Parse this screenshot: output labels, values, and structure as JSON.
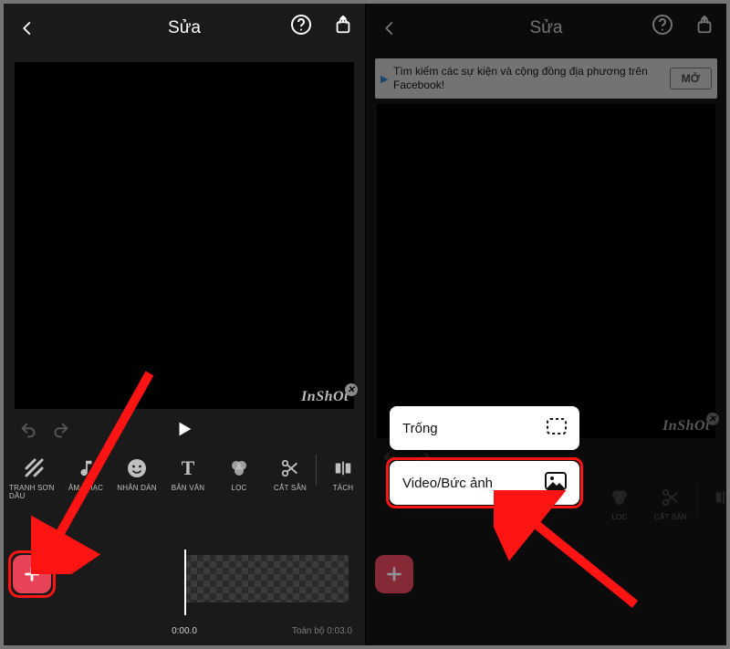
{
  "header": {
    "title": "Sửa"
  },
  "ad": {
    "text": "Tìm kiếm các sự kiện và cộng đồng địa phương trên Facebook!",
    "button": "MỞ"
  },
  "watermark": {
    "text": "InShOt"
  },
  "toolbar": {
    "items": [
      {
        "id": "canvas",
        "label": "TRANH SƠN DẦU",
        "icon": "hatch"
      },
      {
        "id": "music",
        "label": "ÂM NHẠC",
        "icon": "music"
      },
      {
        "id": "sticker",
        "label": "NHÃN DÁN",
        "icon": "smile"
      },
      {
        "id": "text",
        "label": "BẢN VĂN",
        "icon": "text"
      },
      {
        "id": "filter",
        "label": "LỌC",
        "icon": "filter"
      },
      {
        "id": "trim",
        "label": "CẮT SẴN",
        "icon": "scissors"
      },
      {
        "id": "split",
        "label": "TÁCH",
        "icon": "split"
      }
    ]
  },
  "popup": {
    "blank": "Trống",
    "media": "Video/Bức ảnh"
  },
  "timeline": {
    "current": "0:00.0",
    "total_prefix": "Toàn bộ",
    "total": "0:03.0"
  }
}
